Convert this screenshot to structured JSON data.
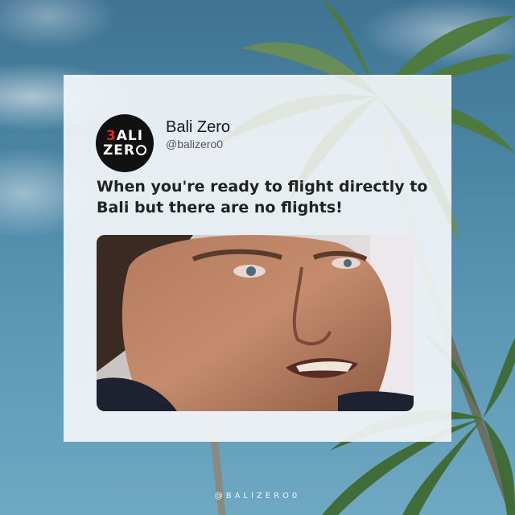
{
  "profile": {
    "avatar_line1_accent": "3",
    "avatar_line1_rest": "ALI",
    "avatar_line2": "ZER",
    "display_name": "Bali Zero",
    "handle": "@balizero0"
  },
  "post": {
    "text": "When you're ready to flight directly to Bali but there are no flights!"
  },
  "footer": {
    "handle": "@BALIZERO0"
  },
  "colors": {
    "card_background": "#f4f6f9",
    "accent_red": "#e0262b",
    "sky": "#4d87a6"
  }
}
